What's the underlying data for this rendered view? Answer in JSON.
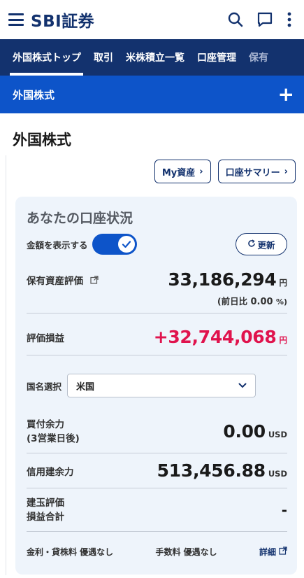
{
  "header": {
    "logo": "SBI証券",
    "icons": [
      "search-icon",
      "chat-icon",
      "more-vertical-icon"
    ]
  },
  "tabs": [
    {
      "label": "外国株式トップ",
      "active": true
    },
    {
      "label": "取引",
      "active": false
    },
    {
      "label": "米株積立一覧",
      "active": false
    },
    {
      "label": "口座管理",
      "active": false
    },
    {
      "label": "保有",
      "active": false
    }
  ],
  "section_bar": {
    "title": "外国株式",
    "plus": "+"
  },
  "page_title": "外国株式",
  "buttons": {
    "my_assets": "My資産",
    "account_summary": "口座サマリー",
    "refresh": "更新"
  },
  "card": {
    "title": "あなたの口座状況",
    "toggle_label": "金額を表示する",
    "toggle_on": true,
    "holdings": {
      "label": "保有資産評価",
      "value": "33,186,294",
      "unit": "円"
    },
    "previous_day": {
      "prefix": "(前日比",
      "value": "0.00",
      "suffix": "%)"
    },
    "profit_loss": {
      "label": "評価損益",
      "value": "+32,744,068",
      "unit": "円"
    },
    "country": {
      "label": "国名選択",
      "selected": "米国"
    },
    "buying_power": {
      "label_line1": "買付余力",
      "label_line2": "(3営業日後)",
      "value": "0.00",
      "unit": "USD"
    },
    "credit_power": {
      "label": "信用建余力",
      "value": "513,456.88",
      "unit": "USD"
    },
    "position_eval": {
      "label_line1": "建玉評価",
      "label_line2": "損益合計",
      "value": "-"
    },
    "footer": {
      "text1": "金利・貸株料 優遇なし",
      "text2": "手数料 優遇なし",
      "detail": "詳細"
    }
  },
  "colors": {
    "navy": "#13326e",
    "blue": "#0d54c9",
    "red": "#e0134d",
    "card_bg": "#eef4fb"
  }
}
